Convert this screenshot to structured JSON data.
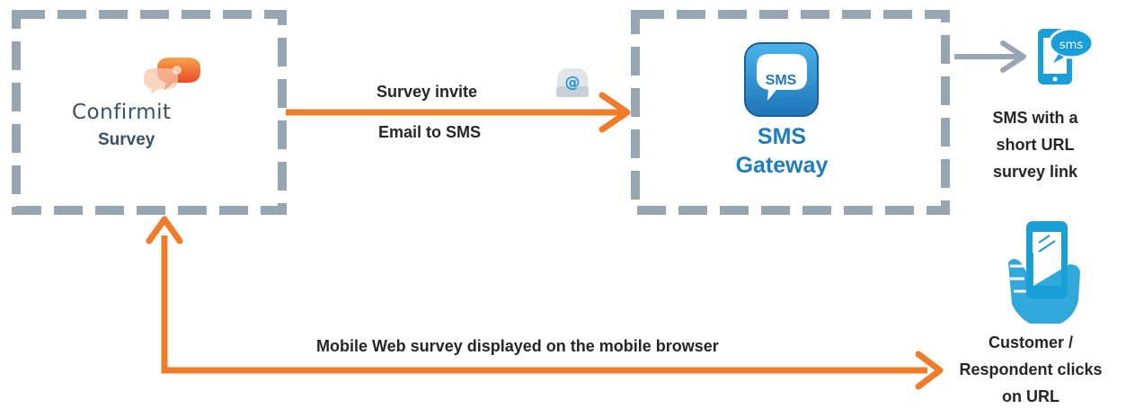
{
  "diagram": {
    "source": {
      "brand": "Confirmit",
      "product": "Survey"
    },
    "gateway": {
      "icon_text": "SMS",
      "title_line1": "SMS",
      "title_line2": "Gateway"
    },
    "edges": {
      "invite_label": "Survey invite",
      "email_label": "Email to SMS",
      "mobile_label": "Mobile Web survey displayed on the mobile browser"
    },
    "phone_sms_bubble": "sms",
    "sms_text": {
      "line1": "SMS with a",
      "line2": "short URL",
      "line3": "survey link"
    },
    "respondent_text": {
      "line1": "Customer /",
      "line2": "Respondent clicks",
      "line3": "on URL"
    },
    "colors": {
      "dash_border": "#97a6b3",
      "orange_arrow": "#f07b28",
      "gray_arrow": "#97a6b3",
      "gateway_blue": "#1e7dbc",
      "phone_blue": "#1a9ed8",
      "text_dark": "#262626"
    },
    "icons": [
      "speech-bubbles-logo-icon",
      "email-at-icon",
      "sms-app-icon",
      "phone-sms-icon",
      "hand-phone-icon"
    ]
  }
}
